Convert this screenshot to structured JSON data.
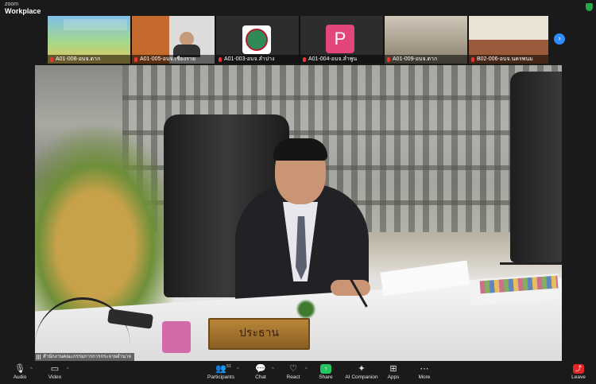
{
  "app": {
    "name_top": "zoom",
    "name_bottom": "Workplace"
  },
  "gallery": [
    {
      "label": "A01-008-อบจ.ตาก"
    },
    {
      "label": "A01-005-อบจ.เชียงราย"
    },
    {
      "label": "A01-003-อบจ.ลำปาง"
    },
    {
      "label": "A01-004-อบจ.ลำพูน",
      "avatar_letter": "P",
      "avatar_color": "#e2467a"
    },
    {
      "label": "A01-009-อบจ.ตาก"
    },
    {
      "label": "B02-006-อบจ.นครพนม"
    }
  ],
  "main_video": {
    "speaker_name": "สำนักงานคณะกรรมการการกระจายอำนาจ",
    "nameplate": "ประธาน"
  },
  "toolbar": {
    "audio": "Audio",
    "video": "Video",
    "participants": "Participants",
    "participants_count": "51",
    "chat": "Chat",
    "react": "React",
    "share": "Share",
    "ai": "AI Companion",
    "apps": "Apps",
    "more": "More",
    "leave": "Leave"
  },
  "colors": {
    "accent": "#2d8cff",
    "share": "#22c55e",
    "leave": "#e02828"
  }
}
